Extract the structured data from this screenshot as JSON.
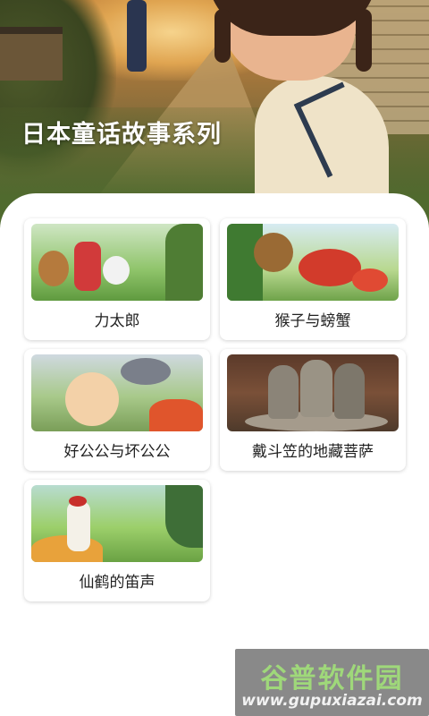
{
  "hero": {
    "title": "日本童话故事系列"
  },
  "stories": [
    {
      "title": "力太郎"
    },
    {
      "title": "猴子与螃蟹"
    },
    {
      "title": "好公公与坏公公"
    },
    {
      "title": "戴斗笠的地藏菩萨"
    },
    {
      "title": "仙鹤的笛声"
    }
  ],
  "watermark": {
    "name": "谷普软件园",
    "url": "www.gupuxiazai.com"
  }
}
